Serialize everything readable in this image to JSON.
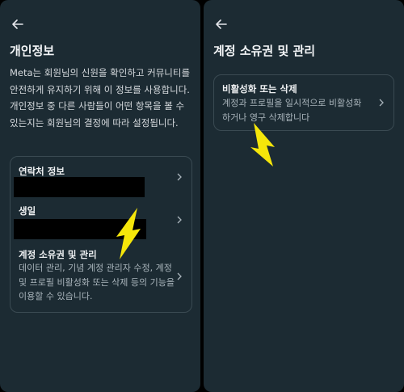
{
  "left": {
    "title": "개인정보",
    "description": "Meta는 회원님의 신원을 확인하고 커뮤니티를 안전하게 유지하기 위해 이 정보를 사용합니다. 개인정보 중 다른 사람들이 어떤 항목을 볼 수 있는지는 회원님의 결정에 따라 설정됩니다.",
    "items": [
      {
        "title": "연락처 정보"
      },
      {
        "title": "생일"
      },
      {
        "title": "계정 소유권 및 관리",
        "subtitle": "데이터 관리, 기념 계정 관리자 수정, 계정 및 프로필 비활성화 또는 삭제 등의 기능을 이용할 수 있습니다."
      }
    ]
  },
  "right": {
    "title": "계정 소유권 및 관리",
    "items": [
      {
        "title": "비활성화 또는 삭제",
        "subtitle": "계정과 프로필을 일시적으로 비활성화하거나 영구 삭제합니다"
      }
    ]
  },
  "colors": {
    "panel_bg": "#1c2b33",
    "card_border": "#3a4a52",
    "annotation_arrow": "#f5e60a"
  },
  "icons": {
    "back": "left-arrow-icon",
    "chevron": "chevron-right-icon",
    "annotation": "yellow-pointer-arrow"
  }
}
